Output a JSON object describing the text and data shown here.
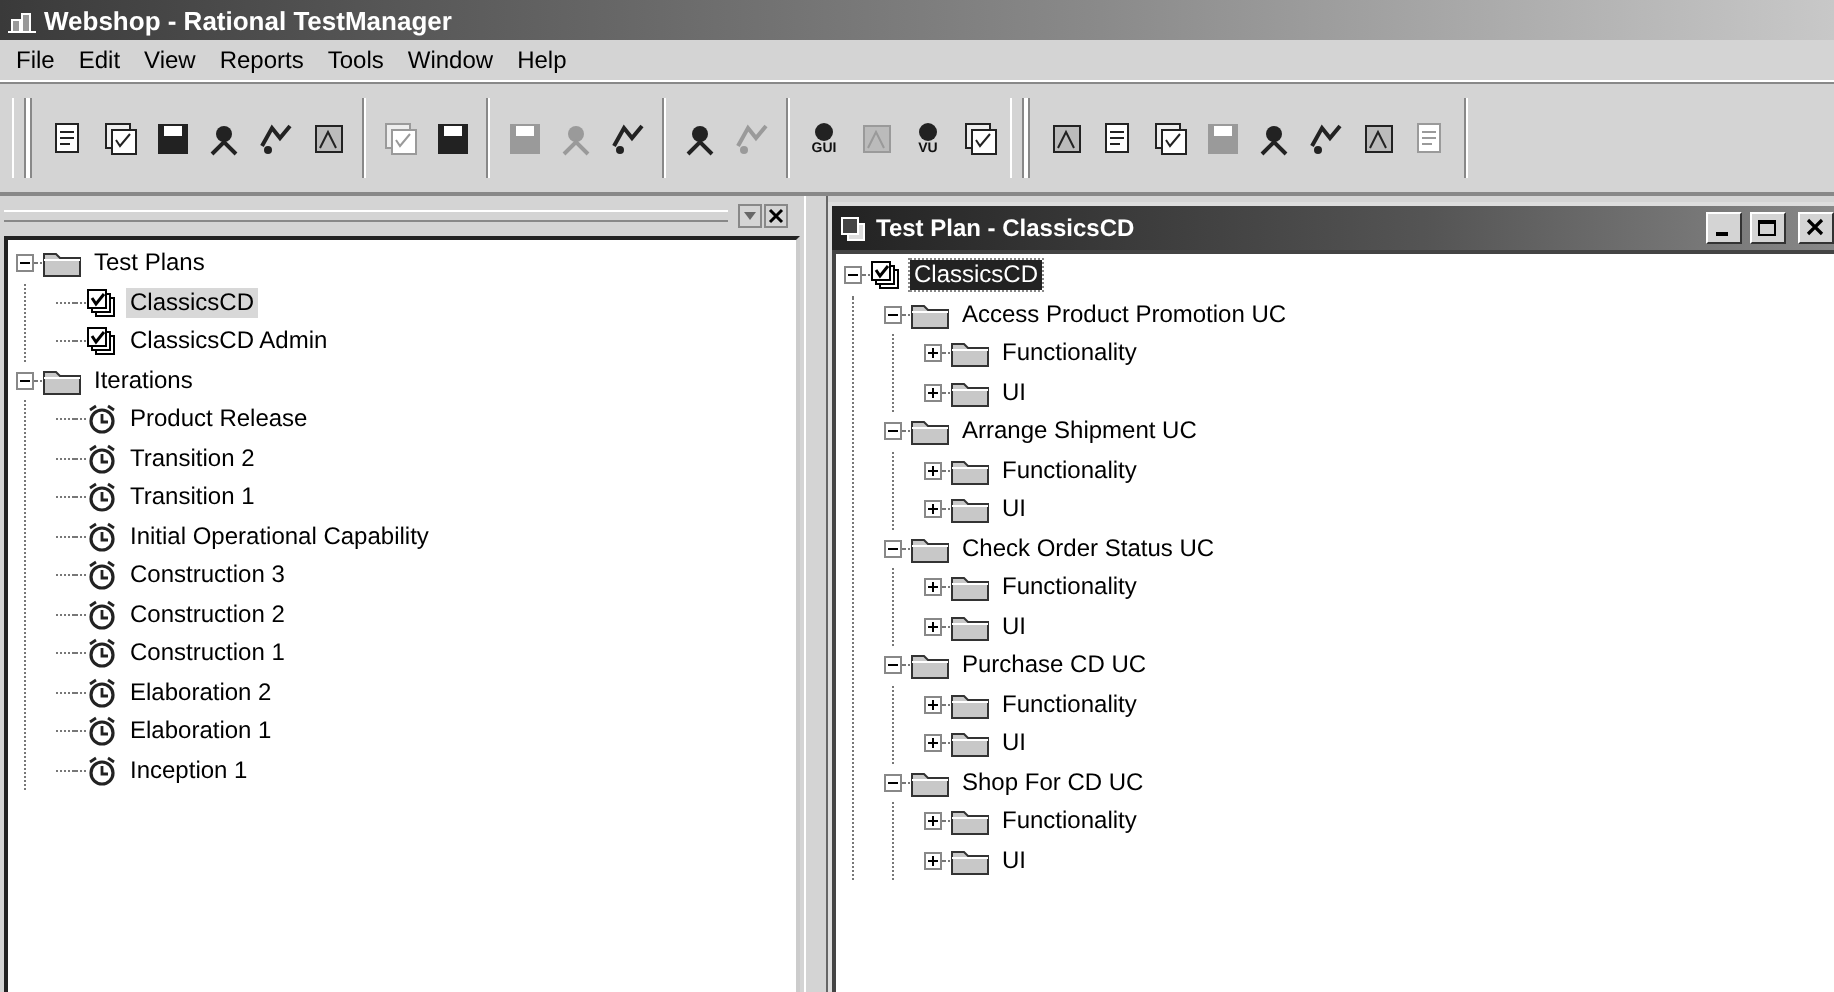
{
  "window": {
    "title": "Webshop - Rational TestManager"
  },
  "menu": [
    "File",
    "Edit",
    "View",
    "Reports",
    "Tools",
    "Window",
    "Help"
  ],
  "toolbar": [
    [
      {
        "disabled": false
      },
      {
        "disabled": false
      },
      {
        "disabled": false
      },
      {
        "disabled": false
      },
      {
        "disabled": false
      },
      {
        "disabled": false
      }
    ],
    [
      {
        "disabled": true
      },
      {
        "disabled": false
      }
    ],
    [
      {
        "disabled": true
      },
      {
        "disabled": true
      },
      {
        "disabled": false
      }
    ],
    [
      {
        "disabled": false
      },
      {
        "disabled": true
      }
    ],
    [
      {
        "disabled": false,
        "label": "GUI"
      },
      {
        "disabled": true
      },
      {
        "disabled": false,
        "label": "VU"
      },
      {
        "disabled": false
      }
    ],
    [
      {
        "disabled": false
      },
      {
        "disabled": false
      },
      {
        "disabled": false
      },
      {
        "disabled": true
      },
      {
        "disabled": false
      },
      {
        "disabled": false
      },
      {
        "disabled": false
      },
      {
        "disabled": true
      }
    ]
  ],
  "left_tree": [
    {
      "kind": "folder",
      "label": "Test Plans",
      "expanded": true,
      "selected": false,
      "children": [
        {
          "kind": "plan",
          "label": "ClassicsCD",
          "selected": true
        },
        {
          "kind": "plan",
          "label": "ClassicsCD Admin",
          "selected": false
        }
      ]
    },
    {
      "kind": "folder",
      "label": "Iterations",
      "expanded": true,
      "selected": false,
      "children": [
        {
          "kind": "iteration",
          "label": "Product Release",
          "selected": false
        },
        {
          "kind": "iteration",
          "label": "Transition 2",
          "selected": false
        },
        {
          "kind": "iteration",
          "label": "Transition 1",
          "selected": false
        },
        {
          "kind": "iteration",
          "label": "Initial Operational Capability",
          "selected": false
        },
        {
          "kind": "iteration",
          "label": "Construction 3",
          "selected": false
        },
        {
          "kind": "iteration",
          "label": "Construction 2",
          "selected": false
        },
        {
          "kind": "iteration",
          "label": "Construction 1",
          "selected": false
        },
        {
          "kind": "iteration",
          "label": "Elaboration 2",
          "selected": false
        },
        {
          "kind": "iteration",
          "label": "Elaboration 1",
          "selected": false
        },
        {
          "kind": "iteration",
          "label": "Inception 1",
          "selected": false
        }
      ]
    }
  ],
  "document": {
    "title": "Test Plan - ClassicsCD",
    "tree": [
      {
        "kind": "plan",
        "label": "ClassicsCD",
        "expanded": true,
        "selected": true,
        "children": [
          {
            "kind": "folder",
            "label": "Access Product Promotion UC",
            "expanded": true,
            "selected": false,
            "children": [
              {
                "kind": "folder",
                "label": "Functionality",
                "expanded": false,
                "selected": false
              },
              {
                "kind": "folder",
                "label": "UI",
                "expanded": false,
                "selected": false
              }
            ]
          },
          {
            "kind": "folder",
            "label": "Arrange Shipment UC",
            "expanded": true,
            "selected": false,
            "children": [
              {
                "kind": "folder",
                "label": "Functionality",
                "expanded": false,
                "selected": false
              },
              {
                "kind": "folder",
                "label": "UI",
                "expanded": false,
                "selected": false
              }
            ]
          },
          {
            "kind": "folder",
            "label": "Check Order Status UC",
            "expanded": true,
            "selected": false,
            "children": [
              {
                "kind": "folder",
                "label": "Functionality",
                "expanded": false,
                "selected": false
              },
              {
                "kind": "folder",
                "label": "UI",
                "expanded": false,
                "selected": false
              }
            ]
          },
          {
            "kind": "folder",
            "label": "Purchase CD UC",
            "expanded": true,
            "selected": false,
            "children": [
              {
                "kind": "folder",
                "label": "Functionality",
                "expanded": false,
                "selected": false
              },
              {
                "kind": "folder",
                "label": "UI",
                "expanded": false,
                "selected": false
              }
            ]
          },
          {
            "kind": "folder",
            "label": "Shop For CD UC",
            "expanded": true,
            "selected": false,
            "children": [
              {
                "kind": "folder",
                "label": "Functionality",
                "expanded": false,
                "selected": false
              },
              {
                "kind": "folder",
                "label": "UI",
                "expanded": false,
                "selected": false
              }
            ]
          }
        ]
      }
    ]
  }
}
